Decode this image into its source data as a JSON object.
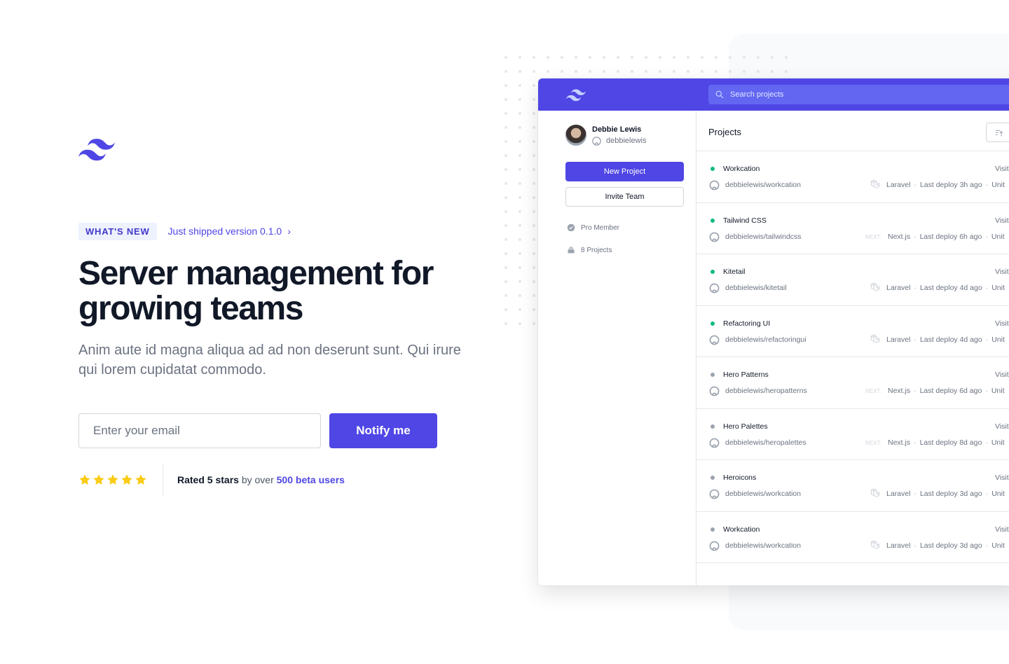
{
  "brand": {
    "accent": "#4f46e5",
    "logo_icon": "tailwind-wave-logo"
  },
  "hero": {
    "badge": "WHAT'S NEW",
    "badge_link": "Just shipped version 0.1.0",
    "headline_line1": "Server management for",
    "headline_line2": "growing teams",
    "subtext": "Anim aute id magna aliqua ad ad non deserunt sunt. Qui irure qui lorem cupidatat commodo.",
    "email_placeholder": "Enter your email",
    "notify_label": "Notify me",
    "rating": {
      "stars": 5,
      "prefix": "Rated 5 stars",
      "middle": " by over ",
      "link": "500 beta users"
    }
  },
  "app": {
    "search_placeholder": "Search projects",
    "user": {
      "name": "Debbie Lewis",
      "handle": "debbielewis"
    },
    "new_project": "New Project",
    "invite_team": "Invite Team",
    "meta": {
      "membership": "Pro Member",
      "projects_count": "8 Projects"
    },
    "projects_title": "Projects",
    "projects": [
      {
        "name": "Workcation",
        "repo": "debbielewis/workcation",
        "framework": "Laravel",
        "deploy": "Last deploy 3h ago",
        "status": "active",
        "visit": "Visit",
        "region": "Unit"
      },
      {
        "name": "Tailwind CSS",
        "repo": "debbielewis/tailwindcss",
        "framework": "Next.js",
        "deploy": "Last deploy 6h ago",
        "status": "active",
        "visit": "Visit",
        "region": "Unit"
      },
      {
        "name": "Kitetail",
        "repo": "debbielewis/kitetail",
        "framework": "Laravel",
        "deploy": "Last deploy 4d ago",
        "status": "active",
        "visit": "Visit",
        "region": "Unit"
      },
      {
        "name": "Refactoring UI",
        "repo": "debbielewis/refactoringui",
        "framework": "Laravel",
        "deploy": "Last deploy 4d ago",
        "status": "active",
        "visit": "Visit",
        "region": "Unit"
      },
      {
        "name": "Hero Patterns",
        "repo": "debbielewis/heropatterns",
        "framework": "Next.js",
        "deploy": "Last deploy 6d ago",
        "status": "inactive",
        "visit": "Visit",
        "region": "Unit"
      },
      {
        "name": "Hero Palettes",
        "repo": "debbielewis/heropalettes",
        "framework": "Next.js",
        "deploy": "Last deploy 8d ago",
        "status": "inactive",
        "visit": "Visit",
        "region": "Unit"
      },
      {
        "name": "Heroicons",
        "repo": "debbielewis/workcation",
        "framework": "Laravel",
        "deploy": "Last deploy 3d ago",
        "status": "inactive",
        "visit": "Visit",
        "region": "Unit"
      },
      {
        "name": "Workcation",
        "repo": "debbielewis/workcation",
        "framework": "Laravel",
        "deploy": "Last deploy 3d ago",
        "status": "inactive",
        "visit": "Visit",
        "region": "Unit"
      }
    ],
    "status_colors": {
      "active": "#10b981",
      "inactive": "#9ca3af"
    }
  }
}
